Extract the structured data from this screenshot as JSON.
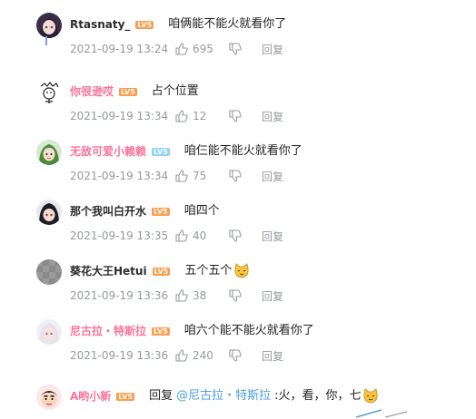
{
  "comments": [
    {
      "username": "Rtasnaty_",
      "username_color": "#2b2b2b",
      "level": "LV5",
      "level_color": "#ff9a4a",
      "text": "咱俩能不能火就看你了",
      "time": "2021-09-19 13:24",
      "likes": "695",
      "reply": "回复",
      "avatar_icon": "anime-girl-avatar"
    },
    {
      "username": "你很逊哎",
      "username_color": "#fb7299",
      "level": "LV5",
      "level_color": "#ff9a4a",
      "text": "占个位置",
      "time": "2021-09-19 13:34",
      "likes": "12",
      "reply": "回复",
      "avatar_icon": "sketch-avatar"
    },
    {
      "username": "无敌可爱小赖赖",
      "username_color": "#fb7299",
      "level": "LV5",
      "level_color": "#8fd3f5",
      "text": "咱仨能不能火就看你了",
      "time": "2021-09-19 13:34",
      "likes": "75",
      "reply": "回复",
      "avatar_icon": "green-hair-avatar"
    },
    {
      "username": "那个我叫白开水",
      "username_color": "#2b2b2b",
      "level": "LV5",
      "level_color": "#ff9a4a",
      "text": "咱四个",
      "time": "2021-09-19 13:35",
      "likes": "40",
      "reply": "回复",
      "avatar_icon": "dark-hair-avatar"
    },
    {
      "username": "葵花大王Hetui",
      "username_color": "#2b2b2b",
      "level": "LV5",
      "level_color": "#ff9a4a",
      "text": "五个五个",
      "time": "2021-09-19 13:36",
      "likes": "38",
      "reply": "回复",
      "avatar_icon": "gray-avatar",
      "emoji": "cat-face-emoji"
    },
    {
      "username": "尼古拉・特斯拉",
      "username_color": "#fb7299",
      "level": "LV5",
      "level_color": "#ff9a4a",
      "text": "咱六个能不能火就看你了",
      "time": "2021-09-19 13:36",
      "likes": "240",
      "reply": "回复",
      "avatar_icon": "white-hair-avatar"
    },
    {
      "username": "A哟小新",
      "username_color": "#fb7299",
      "level": "LV5",
      "level_color": "#ff9a4a",
      "reply_prefix": "回复",
      "mention": "@尼古拉・特斯拉",
      "text": ":火，看，你，七",
      "avatar_icon": "shinchan-avatar",
      "emoji": "cat-face-emoji"
    }
  ],
  "colors": {
    "meta_gray": "#9499a0",
    "link_blue": "#4e9ed8",
    "vip_pink": "#fb7299"
  }
}
